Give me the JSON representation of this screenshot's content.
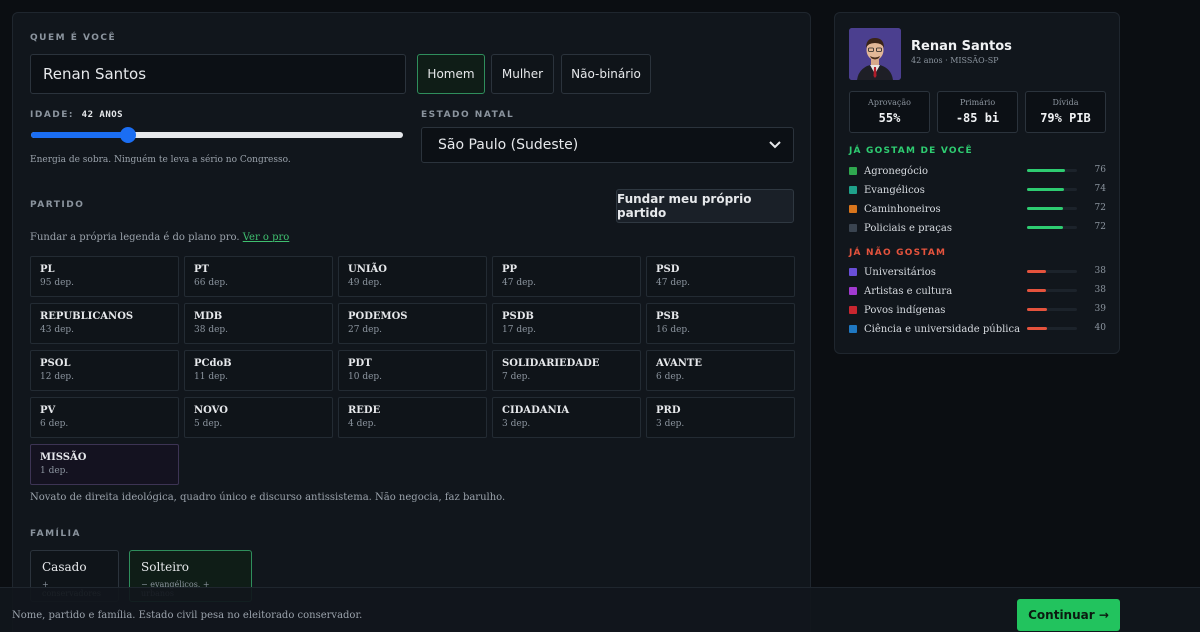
{
  "identity": {
    "section_label": "QUEM É VOCÊ",
    "name_value": "Renan Santos",
    "genders": [
      {
        "label": "Homem",
        "selected": true
      },
      {
        "label": "Mulher",
        "selected": false
      },
      {
        "label": "Não-binário",
        "selected": false
      }
    ]
  },
  "age": {
    "label": "IDADE:",
    "value_text": "42 ANOS",
    "value": 42,
    "min": 25,
    "max": 90,
    "hint": "Energia de sobra. Ninguém te leva a sério no Congresso."
  },
  "state": {
    "label": "ESTADO NATAL",
    "selected": "São Paulo (Sudeste)"
  },
  "party": {
    "label": "PARTIDO",
    "found_button": "Fundar meu próprio partido",
    "pro_hint": "Fundar a própria legenda é do plano pro.",
    "pro_link": "Ver o pro",
    "items": [
      {
        "name": "PL",
        "seats": "95 dep."
      },
      {
        "name": "PT",
        "seats": "66 dep."
      },
      {
        "name": "UNIÃO",
        "seats": "49 dep."
      },
      {
        "name": "PP",
        "seats": "47 dep."
      },
      {
        "name": "PSD",
        "seats": "47 dep."
      },
      {
        "name": "REPUBLICANOS",
        "seats": "43 dep."
      },
      {
        "name": "MDB",
        "seats": "38 dep."
      },
      {
        "name": "PODEMOS",
        "seats": "27 dep."
      },
      {
        "name": "PSDB",
        "seats": "17 dep."
      },
      {
        "name": "PSB",
        "seats": "16 dep."
      },
      {
        "name": "PSOL",
        "seats": "12 dep."
      },
      {
        "name": "PCdoB",
        "seats": "11 dep."
      },
      {
        "name": "PDT",
        "seats": "10 dep."
      },
      {
        "name": "SOLIDARIEDADE",
        "seats": "7 dep."
      },
      {
        "name": "AVANTE",
        "seats": "6 dep."
      },
      {
        "name": "PV",
        "seats": "6 dep."
      },
      {
        "name": "NOVO",
        "seats": "5 dep."
      },
      {
        "name": "REDE",
        "seats": "4 dep."
      },
      {
        "name": "CIDADANIA",
        "seats": "3 dep."
      },
      {
        "name": "PRD",
        "seats": "3 dep."
      },
      {
        "name": "MISSÃO",
        "seats": "1 dep.",
        "selected": true
      }
    ],
    "description": "Novato de direita ideológica, quadro único e discurso antissistema. Não negocia, faz barulho."
  },
  "family": {
    "label": "FAMÍLIA",
    "options": [
      {
        "title": "Casado",
        "sub": "+ conservadores",
        "selected": false
      },
      {
        "title": "Solteiro",
        "sub": "− evangélicos, + urbanos",
        "selected": true
      }
    ]
  },
  "candidate": {
    "name": "Renan Santos",
    "meta": "42 anos · MISSÃO-SP",
    "stats": [
      {
        "label": "Aprovação",
        "value": "55%"
      },
      {
        "label": "Primário",
        "value": "-85 bi"
      },
      {
        "label": "Dívida",
        "value": "79% PIB"
      }
    ],
    "likes_title": "JÁ GOSTAM DE VOCÊ",
    "likes_color": "#2ecc71",
    "likes": [
      {
        "label": "Agronegócio",
        "value": 76,
        "color": "#2fa84f"
      },
      {
        "label": "Evangélicos",
        "value": 74,
        "color": "#1fa18a"
      },
      {
        "label": "Caminhoneiros",
        "value": 72,
        "color": "#d9751c"
      },
      {
        "label": "Policiais e praças",
        "value": 72,
        "color": "#3a4450"
      }
    ],
    "dislikes_title": "JÁ NÃO GOSTAM",
    "dislikes_color": "#e5533d",
    "dislikes": [
      {
        "label": "Universitários",
        "value": 38,
        "color": "#6a4fd8"
      },
      {
        "label": "Artistas e cultura",
        "value": 38,
        "color": "#a23ad0"
      },
      {
        "label": "Povos indígenas",
        "value": 39,
        "color": "#c9262f"
      },
      {
        "label": "Ciência e universidade pública",
        "value": 40,
        "color": "#1f78c2"
      }
    ]
  },
  "footer": {
    "hint": "Nome, partido e família. Estado civil pesa no eleitorado conservador.",
    "continue_label": "Continuar →"
  }
}
